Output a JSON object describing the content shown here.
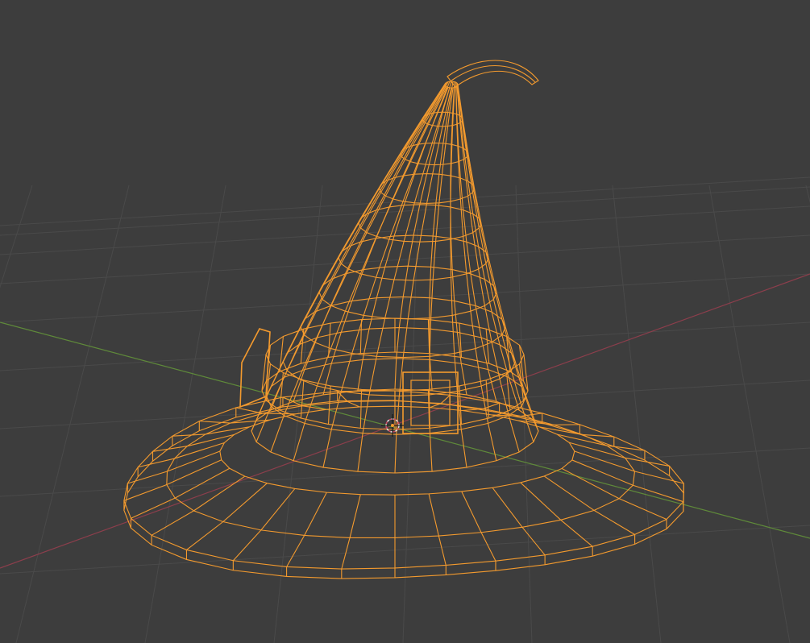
{
  "viewport": {
    "background_color": "#3d3d3d",
    "grid_color": "#4a4a4a",
    "x_axis_color": "#8c3e4c",
    "y_axis_color": "#5f8a3a",
    "selection_color": "#f39a2e",
    "origin_marker_color": "#e9e9e9",
    "origin_marker_accent": "#d04860"
  },
  "scene": {
    "object_name": "witch-hat",
    "display_mode": "wireframe",
    "selected": true
  }
}
